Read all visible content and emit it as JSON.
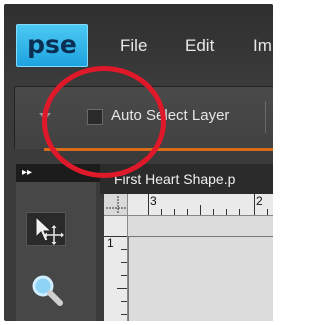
{
  "app": {
    "logo_text": "pse",
    "menu": [
      "File",
      "Edit",
      "Im"
    ]
  },
  "options_bar": {
    "checkbox_label": "Auto Select Layer",
    "checkbox_checked": false
  },
  "panel_toggle": {
    "label": "▸▸"
  },
  "document": {
    "tab_title": "First Heart Shape.p",
    "ruler_h_labels": [
      "3",
      "2"
    ],
    "ruler_v_labels": [
      "1"
    ]
  },
  "tools": [
    {
      "name": "move-tool",
      "icon": "move-arrow-icon"
    },
    {
      "name": "zoom-tool",
      "icon": "magnifier-icon"
    }
  ],
  "colors": {
    "logo_blue": "#1ea3e0",
    "accent_orange": "#d86a1a",
    "annotation_red": "#e0192a"
  }
}
